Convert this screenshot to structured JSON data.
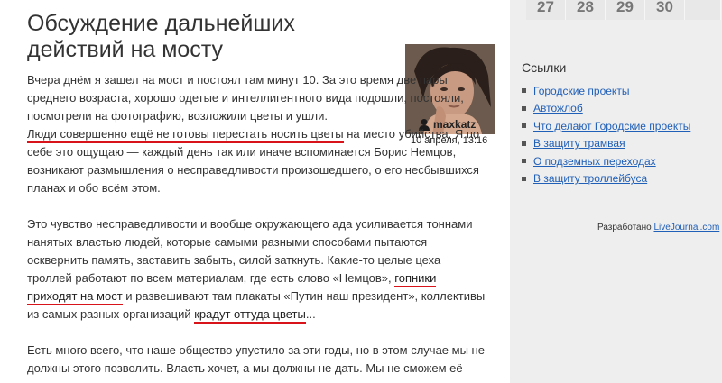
{
  "post": {
    "title": "Обсуждение дальнейших действий на мосту",
    "author": "maxkatz",
    "date": "10 апреля, 13:16",
    "p1": {
      "t1": "Вчера днём я зашел на мост и постоял там минут 10. За это время две пары среднего возраста, хорошо одетые и интеллигентного вида подошли, постояли, посмотрели на фотографию, возложили цветы и ушли.",
      "t2": "Люди совершенно ещё не готовы перестать носить цветы",
      "t3": " на место убийства. Я по себе это ощущаю — каждый день так или иначе вспоминается Борис Немцов, возникают размышления о несправедливости произошедшего, о его несбывшихся планах и обо всём этом."
    },
    "p2": {
      "t1": "Это чувство несправедливости и вообще окружающего ада усиливается тоннами нанятых властью людей, которые самыми разными способами пытаются осквернить память, заставить забыть, силой заткнуть. Какие-то целые цеха троллей работают по всем материалам, где есть слово «Немцов», ",
      "link1": "гопники приходят на мост",
      "t2": " и развешивают там плакаты «Путин наш президент», коллективы из самых разных организаций ",
      "link2": "крадут оттуда цветы",
      "t3": "..."
    },
    "p3": {
      "t1": "Есть много всего, что наше общество упустило за эти годы, но в этом случае мы не должны этого позволить. Власть хочет, а мы должны не дать. Мы не сможем её"
    }
  },
  "calendar": [
    "27",
    "28",
    "29",
    "30"
  ],
  "sidebar": {
    "links_title": "Ссылки",
    "links": [
      "Городские проекты",
      "Автожлоб",
      "Что делают Городские проекты",
      "В защиту трамвая",
      "О подземных переходах",
      "В защиту троллейбуса"
    ],
    "credit_text": "Разработано ",
    "credit_link": "LiveJournal.com"
  },
  "colors": {
    "link": "#2160b8",
    "highlight": "#d8141a",
    "sidebar_bg": "#eeeeee"
  }
}
